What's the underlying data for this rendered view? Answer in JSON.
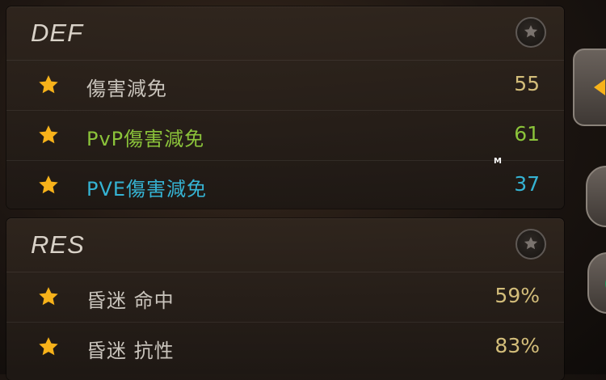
{
  "defense_panel": {
    "title": "DEF",
    "stats": [
      {
        "label": "傷害減免",
        "value": "55"
      },
      {
        "label": "PvP傷害減免",
        "value": "61"
      },
      {
        "label": "PVE傷害減免",
        "value": "37"
      }
    ]
  },
  "resistance_panel": {
    "title": "RES",
    "stats": [
      {
        "label": "昏迷 命中",
        "value": "59%"
      },
      {
        "label": "昏迷 抗性",
        "value": "83%"
      }
    ]
  },
  "cursor_label": "M",
  "colors": {
    "star": "#f7b21a",
    "value_default": "#d3bd7a",
    "pvp": "#8bc33a",
    "pve": "#35b3d3",
    "label_default": "#c9c4bc"
  },
  "icons": {
    "row_marker": "star-icon",
    "favorite": "star-outline-icon"
  }
}
